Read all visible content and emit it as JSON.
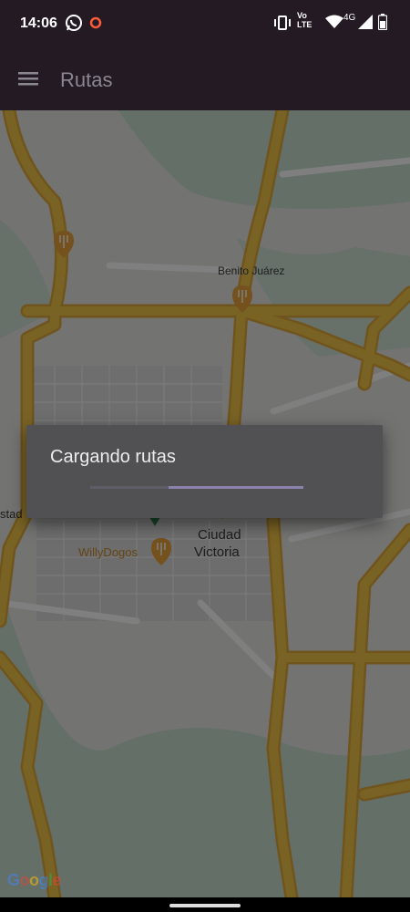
{
  "status_bar": {
    "time": "14:06",
    "icons": [
      "whatsapp-icon",
      "notification-ring-icon",
      "vibrate-icon",
      "volte-icon",
      "wifi-icon",
      "signal-4g-icon",
      "battery-icon"
    ],
    "network_label": "4G",
    "volte_label_top": "Vo",
    "volte_label_bottom": "LTE"
  },
  "app_bar": {
    "title": "Rutas",
    "menu_icon": "hamburger-menu-icon"
  },
  "map": {
    "labels": {
      "benito_juarez": "Benito Juárez",
      "ciudad": "Ciudad",
      "victoria": "Victoria",
      "willydogos": "WillyDogos",
      "estad": "stad"
    },
    "attribution": "Google",
    "colors": {
      "road": "#f2c649",
      "road_edge": "#e0a93a",
      "land": "#e6e6e2",
      "green": "#c8dfcf",
      "poi": "#e8a33a"
    }
  },
  "dialog": {
    "message": "Cargando rutas",
    "progress_indicator": "indeterminate"
  },
  "colors": {
    "app_bar": "#231a24",
    "dialog_bg": "#515052",
    "progress": "#8b82b0",
    "scrim": "rgba(0,0,0,0.5)"
  }
}
